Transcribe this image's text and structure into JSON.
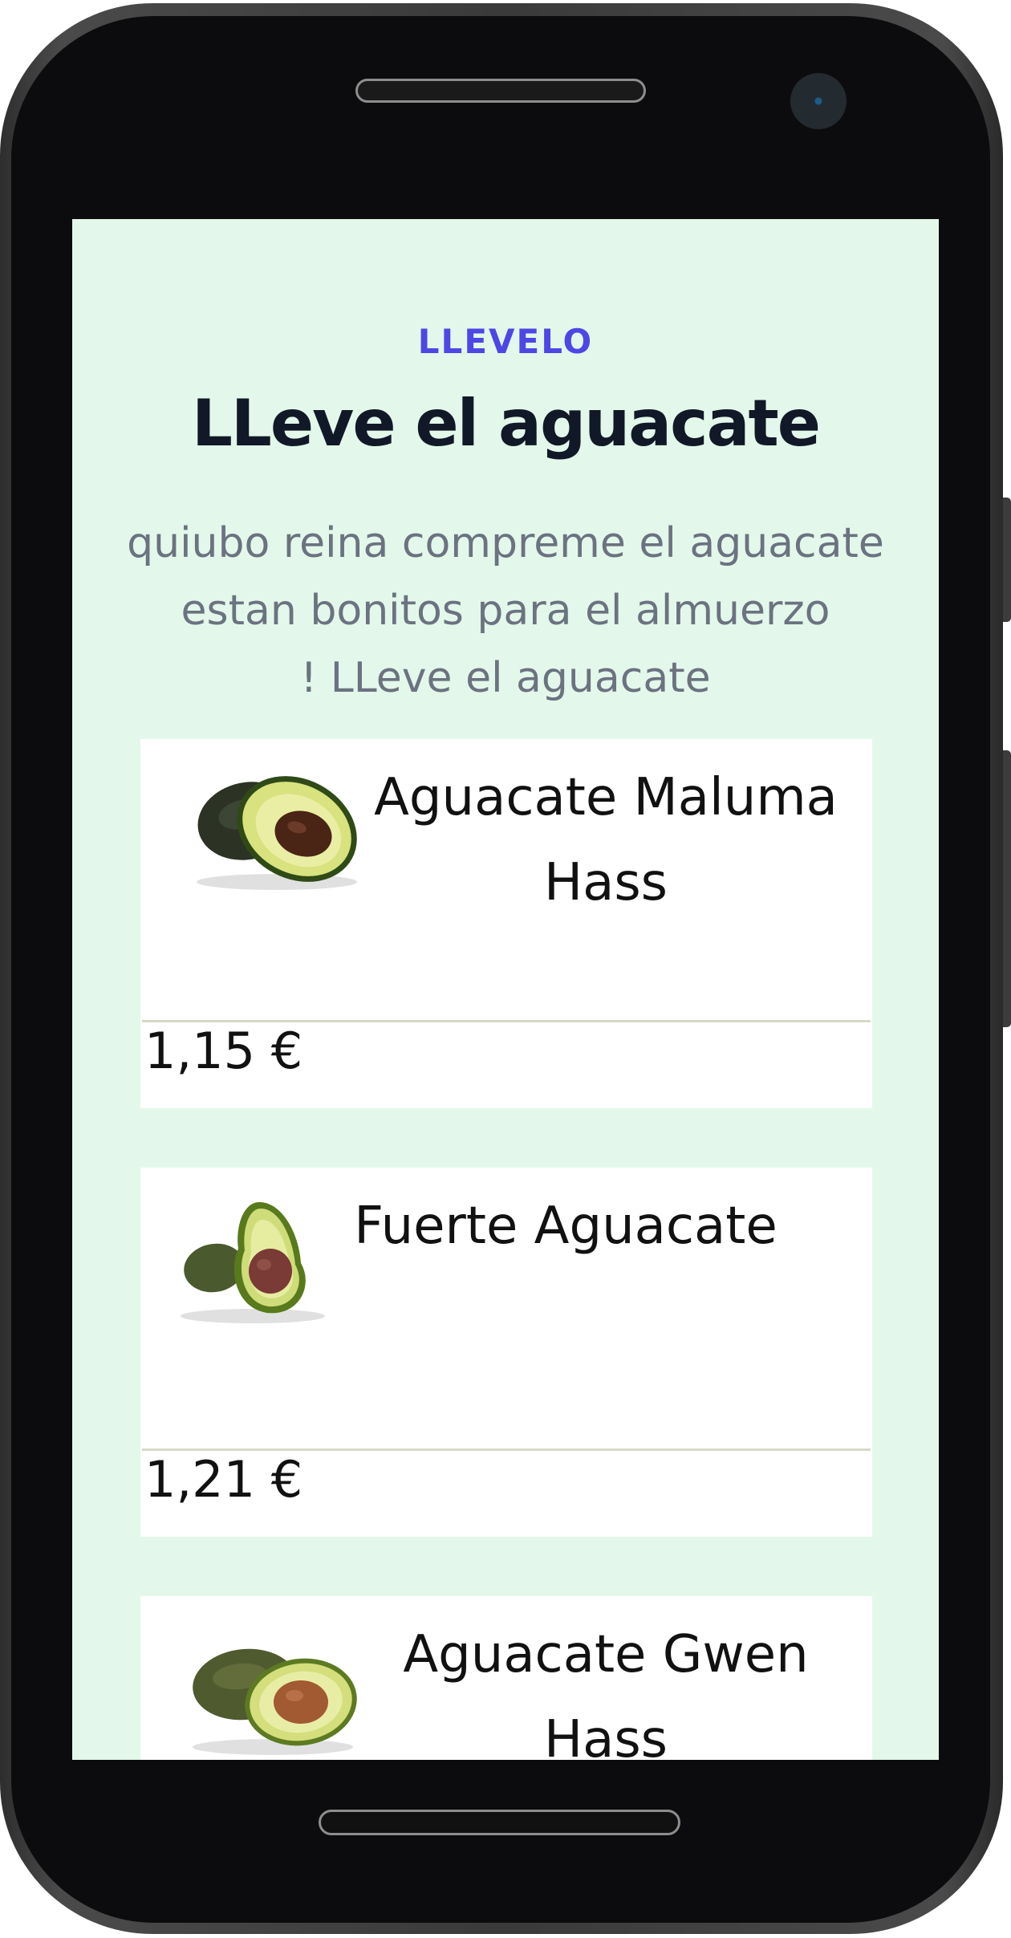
{
  "header": {
    "eyebrow": "LLEVELO",
    "title": "LLeve el aguacate",
    "subtitle_lines": [
      "quiubo reina compreme el aguacate",
      "estan bonitos para el almuerzo",
      "! LLeve el aguacate"
    ]
  },
  "products": [
    {
      "name_lines": [
        "Aguacate Maluma",
        "Hass"
      ],
      "price": "1,15 €",
      "image": "avocado-maluma-image"
    },
    {
      "name_lines": [
        "Fuerte Aguacate"
      ],
      "price": "1,21 €",
      "image": "avocado-fuerte-image"
    },
    {
      "name_lines": [
        "Aguacate Gwen",
        "Hass"
      ],
      "price": "",
      "image": "avocado-gwen-image"
    }
  ],
  "colors": {
    "screen_background": "#e3f8ea",
    "eyebrow": "#4f46e5",
    "title": "#111827",
    "subtitle": "#6b7280",
    "card_background": "#ffffff",
    "phone_body": "#0c0c0e"
  }
}
